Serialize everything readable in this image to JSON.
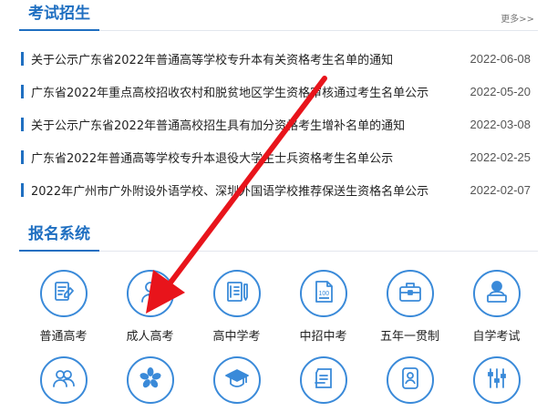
{
  "news": {
    "title": "考试招生",
    "more": "更多>>",
    "items": [
      {
        "text": "关于公示广东省2022年普通高等学校专升本有关资格考生名单的通知",
        "date": "2022-06-08"
      },
      {
        "text": "广东省2022年重点高校招收农村和脱贫地区学生资格审核通过考生名单公示",
        "date": "2022-05-20"
      },
      {
        "text": "关于公示广东省2022年普通高校招生具有加分资格考生增补名单的通知",
        "date": "2022-03-08"
      },
      {
        "text": "广东省2022年普通高等学校专升本退役大学生士兵资格考生名单公示",
        "date": "2022-02-25"
      },
      {
        "text": "2022年广州市广外附设外语学校、深圳外国语学校推荐保送生资格名单公示",
        "date": "2022-02-07"
      }
    ]
  },
  "registration": {
    "title": "报名系统",
    "tiles": [
      {
        "label": "普通高考",
        "icon": "exam-paper-pen-icon"
      },
      {
        "label": "成人高考",
        "icon": "adult-student-icon"
      },
      {
        "label": "高中学考",
        "icon": "document-pen-icon"
      },
      {
        "label": "中招中考",
        "icon": "file-100-icon"
      },
      {
        "label": "五年一贯制",
        "icon": "briefcase-icon"
      },
      {
        "label": "自学考试",
        "icon": "person-computer-icon"
      },
      {
        "label": "",
        "icon": "group-people-icon"
      },
      {
        "label": "",
        "icon": "bauhinia-flower-icon"
      },
      {
        "label": "",
        "icon": "graduation-cap-icon"
      },
      {
        "label": "",
        "icon": "document-list-icon"
      },
      {
        "label": "",
        "icon": "phone-person-icon"
      },
      {
        "label": "",
        "icon": "sliders-icon"
      }
    ]
  },
  "colors": {
    "accent": "#1f6fc1",
    "icon_stroke": "#3a8ad9",
    "arrow": "#e8141b"
  }
}
